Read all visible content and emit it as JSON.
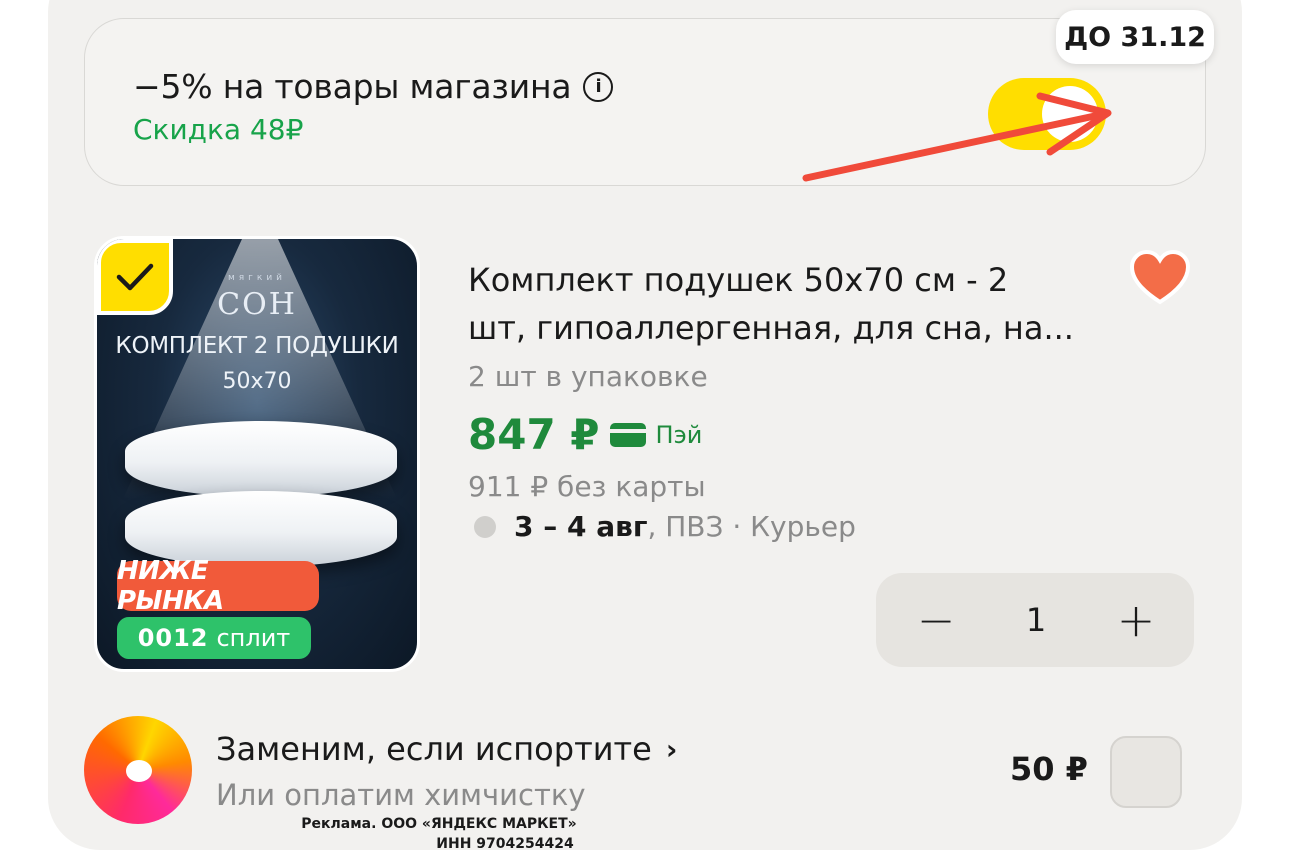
{
  "promo": {
    "title": "−5% на товары магазина",
    "discount": "Скидка 48₽",
    "badge_date": "ДО 31.12",
    "toggle_on": true,
    "info_icon": "info-icon"
  },
  "product": {
    "image": {
      "brand_small": "мягкий",
      "brand": "СОН",
      "kit_label": "КОМПЛЕКТ 2 ПОДУШКИ",
      "size": "50x70",
      "badge_market": "НИЖЕ РЫНКА",
      "split_dots": "0012",
      "split_label": "сплит"
    },
    "selected": true,
    "title_line1": "Комплект подушек 50х70 см - 2",
    "title_line2": "шт, гипоаллергенная, для сна, на...",
    "pack": "2 шт в упаковке",
    "price": "847 ₽",
    "pay_label": "Пэй",
    "old_price": "911 ₽  без карты",
    "delivery_date": "3 – 4 авг",
    "delivery_modes": ", ПВЗ · Курьер",
    "quantity": "1",
    "favorite": true
  },
  "insurance": {
    "title": "Заменим, если испортите",
    "subtitle": "Или оплатим химчистку",
    "price": "50 ₽",
    "checked": false
  },
  "ad": {
    "line1": "Реклама. ООО «ЯНДЕКС МАРКЕТ»",
    "line2": "ИНН 9704254424"
  },
  "colors": {
    "accent_yellow": "#ffde00",
    "price_green": "#1f8a3c",
    "discount_green": "#17a34a",
    "badge_red": "#f15a3a",
    "split_green": "#2ec26a",
    "heart": "#f36d48",
    "annotation_arrow": "#f04a3a"
  }
}
